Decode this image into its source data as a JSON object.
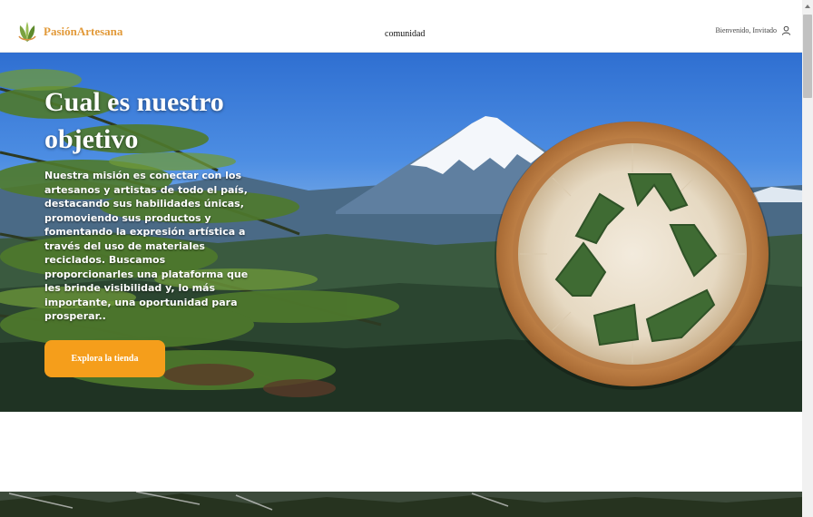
{
  "header": {
    "brand": "PasiónArtesana",
    "nav": {
      "community_label": "comunidad"
    },
    "user": {
      "welcome_text": "Bienvenido, Invitado",
      "icon": "user-icon"
    }
  },
  "hero": {
    "title": "Cual es nuestro objetivo",
    "description": "Nuestra misión es conectar con los artesanos y artistas de todo el país, destacando sus habilidades únicas, promoviendo sus productos y fomentando la expresión artística a través del uso de materiales reciclados. Buscamos proporcionarles una plataforma que les brinde visibilidad y, lo más importante, una oportunidad para prosperar..",
    "cta_label": "Explora la tienda",
    "emblem_icon": "recycle-icon"
  },
  "colors": {
    "brand": "#e29a3a",
    "cta": "#f59e1b",
    "recycle_green": "#3f6b33"
  }
}
